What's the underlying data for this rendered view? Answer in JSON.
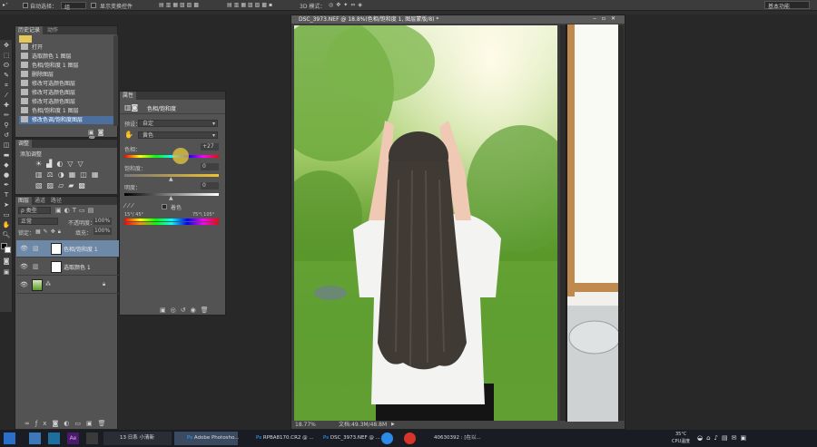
{
  "app": "Adobe Photoshop",
  "options_bar": {
    "auto_select_label": "自动选择：",
    "auto_select_value": "组",
    "transform_label": "显示变换控件",
    "mode_3d_label": "3D 模式：",
    "workspace": "基本功能"
  },
  "history_panel": {
    "tabs": [
      "历史记录",
      "动作"
    ],
    "items": [
      "打开",
      "选取颜色 1 图层",
      "色相/饱和度 1 图层",
      "删除图层",
      "修改可选颜色图层",
      "修改可选颜色图层",
      "修改可选颜色图层",
      "色相/饱和度 1 图层",
      "修改色调/饱和度图层"
    ]
  },
  "adjustments_panel": {
    "title": "调整",
    "subtitle": "添加调整"
  },
  "layers_panel": {
    "tabs": [
      "图层",
      "通道",
      "路径"
    ],
    "kind": "类型",
    "blend_mode": "正常",
    "opacity_label": "不透明度：",
    "opacity": "100%",
    "lock_label": "锁定：",
    "fill_label": "填充：",
    "fill": "100%",
    "layers": [
      {
        "name": "色相/饱和度 1",
        "selected": true
      },
      {
        "name": "选取颜色 1",
        "selected": false
      },
      {
        "name": "",
        "selected": false
      }
    ]
  },
  "properties_panel": {
    "tab": "属性",
    "header": "色相/饱和度",
    "preset_label": "预设：",
    "preset_value": "自定",
    "channel_value": "黄色",
    "hue_label": "色相：",
    "hue_value": "+27",
    "hue_level": 0.6,
    "saturation_label": "饱和度：",
    "saturation_value": "0",
    "lightness_label": "明度：",
    "lightness_value": "0",
    "colorize_label": "着色",
    "range_left": "15°/ 45°",
    "range_right": "75°\\ 105°"
  },
  "document": {
    "title": "DSC_3973.NEF @ 18.8%(色相/饱和度 1, 图层蒙版/8) *",
    "zoom": "18.77%",
    "doc_size": "文档:49.3M/48.8M"
  },
  "taskbar": {
    "items": [
      "13 日系 小清新",
      "Adobe Photosho...",
      "RPBA8170.CR2 @ ...",
      "DSC_3973.NEF @ ...",
      "40630392 : [在以..."
    ],
    "temp": "35°C",
    "cpu": "CPU温度"
  },
  "colors": {
    "selection": "#4d6f9e",
    "panel_bg": "#535353",
    "workspace_bg": "#282828"
  }
}
